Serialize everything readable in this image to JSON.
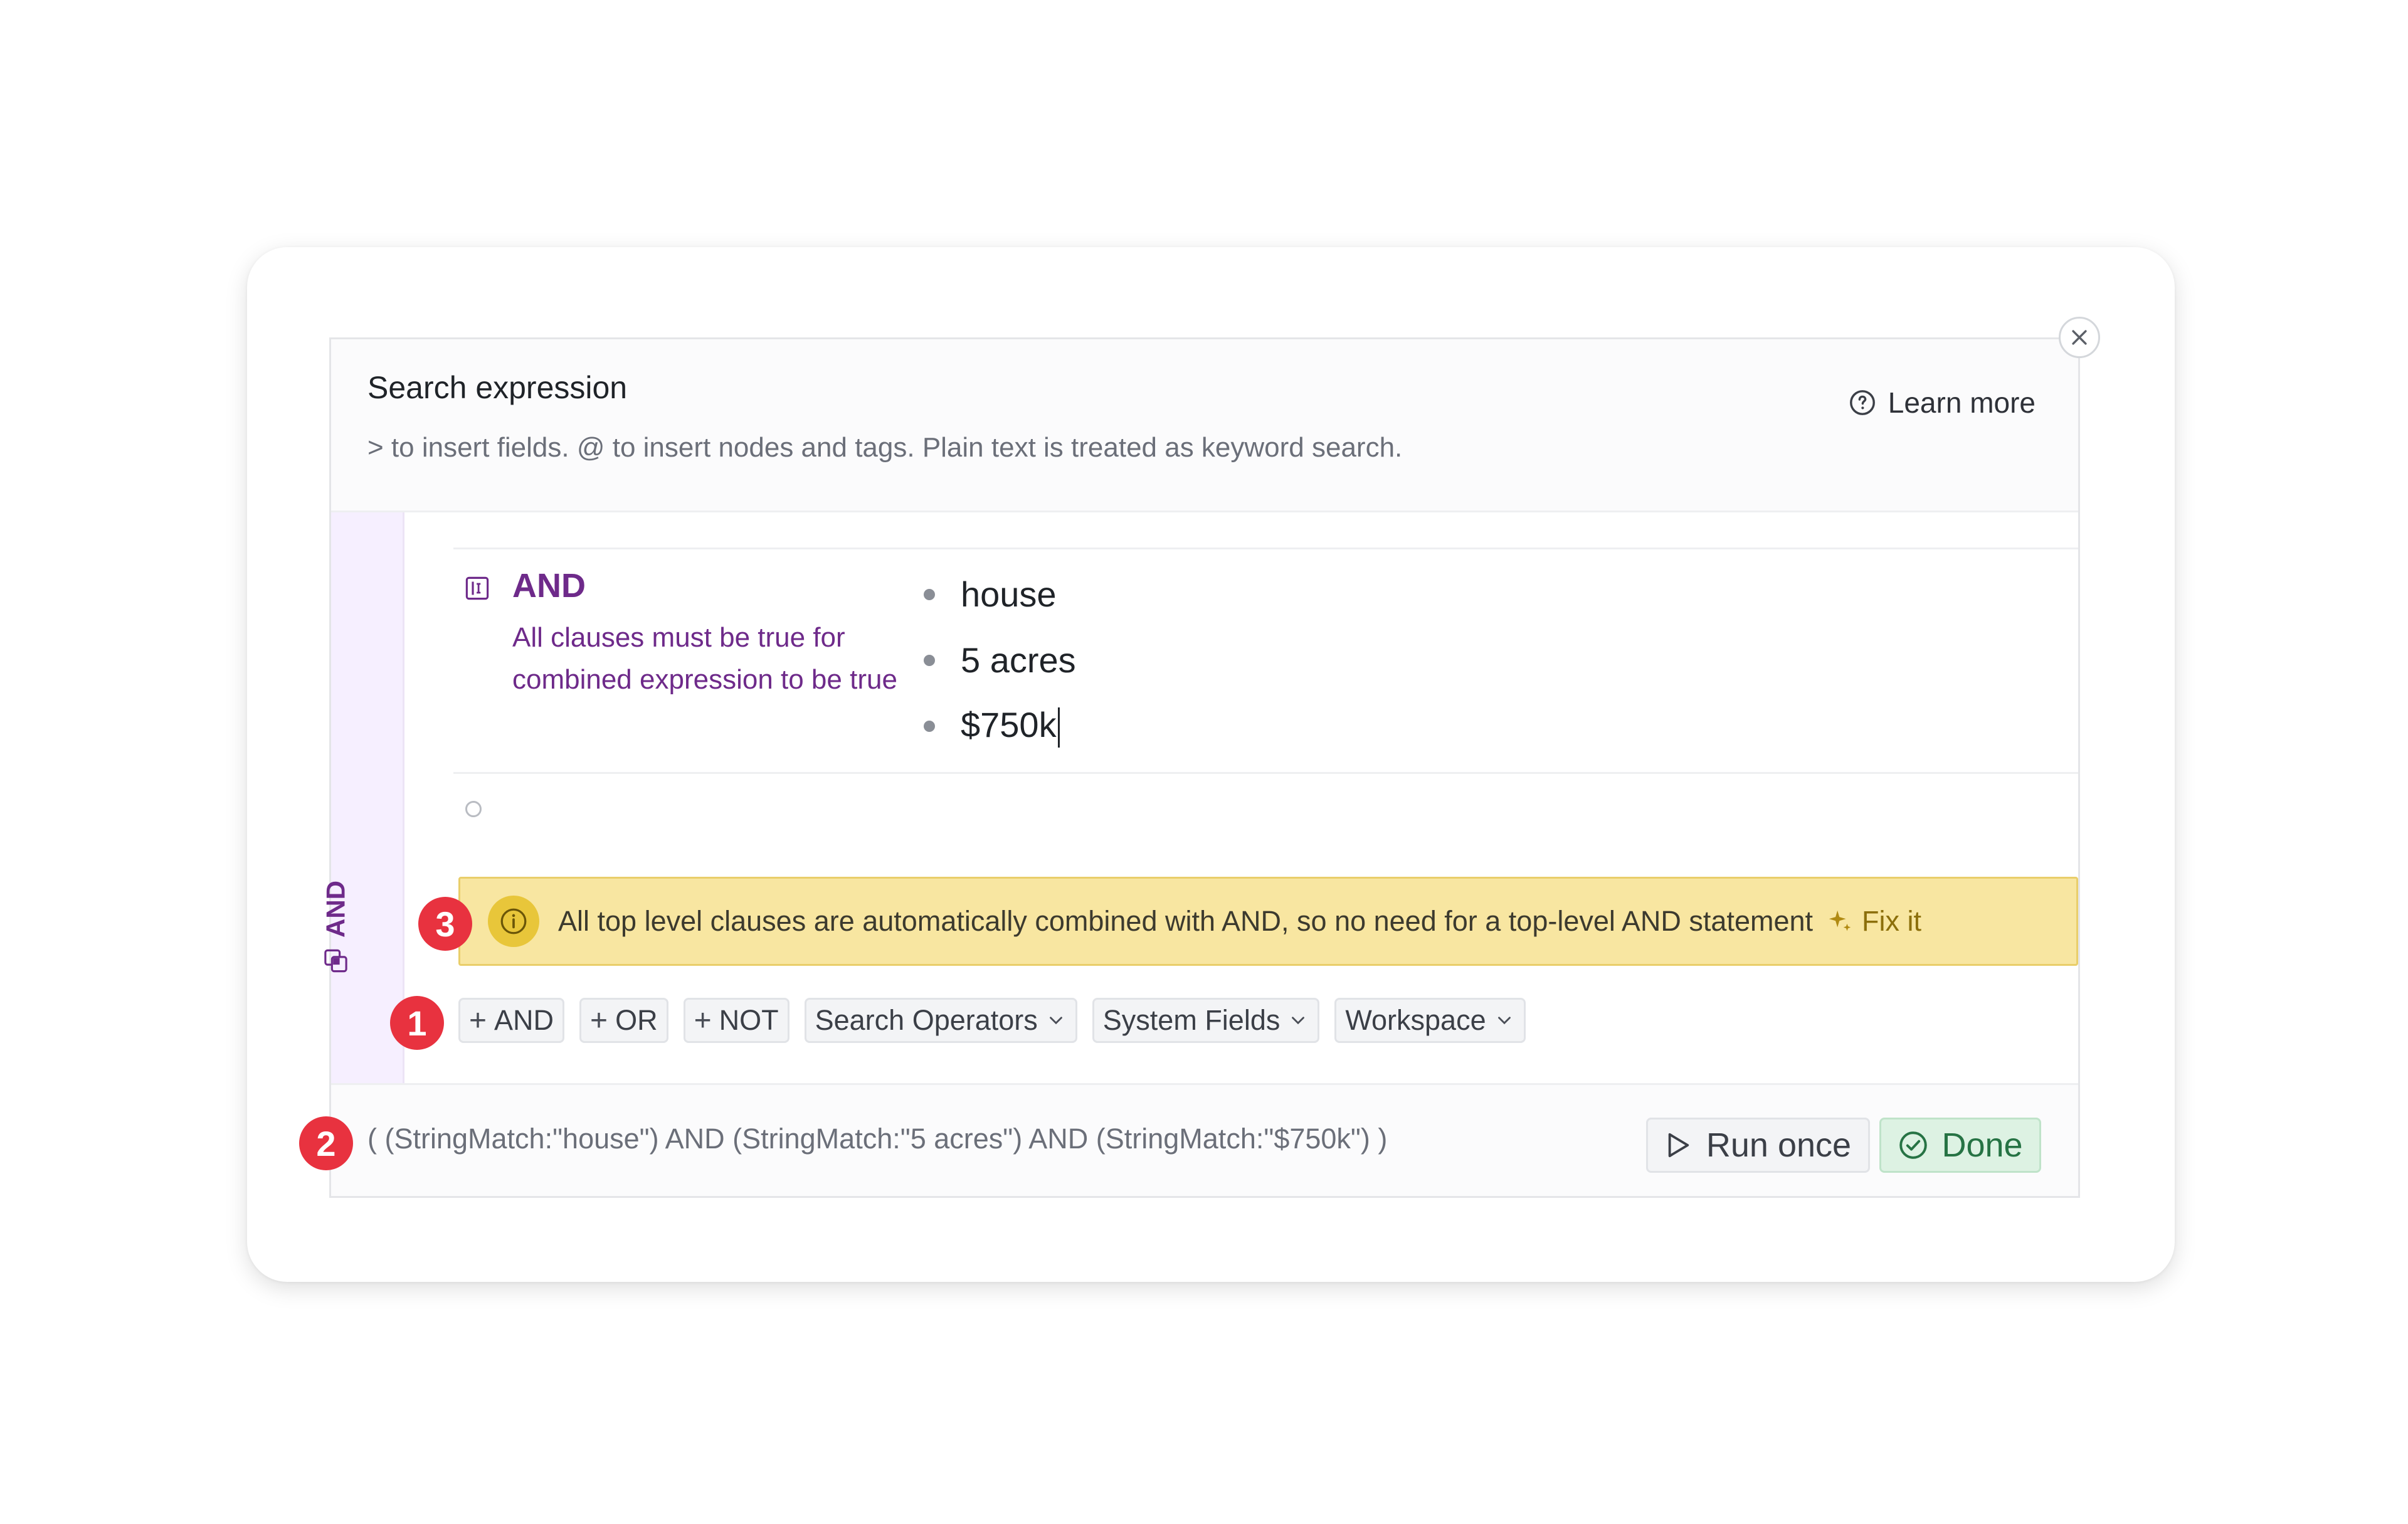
{
  "dialog": {
    "title": "Search expression",
    "hint": "> to insert fields. @ to insert nodes and tags. Plain text is treated as keyword search.",
    "learn_more": "Learn more"
  },
  "side_strip": {
    "label": "AND"
  },
  "and_block": {
    "title": "AND",
    "description": "All clauses must be true for combined expression to be true",
    "clauses": [
      "house",
      "5 acres",
      "$750k"
    ]
  },
  "warning": {
    "text": "All top level clauses are automatically combined with AND, so no need for a top-level AND statement",
    "fix_label": "Fix it"
  },
  "toolbar": {
    "plus_symbol": "+",
    "and_label": "AND",
    "or_label": "OR",
    "not_label": "NOT",
    "search_operators": "Search Operators",
    "system_fields": "System Fields",
    "workspace": "Workspace"
  },
  "footer": {
    "expression": "( (StringMatch:\"house\") AND (StringMatch:\"5 acres\") AND (StringMatch:\"$750k\") )",
    "run_once": "Run once",
    "done": "Done"
  },
  "callouts": [
    "1",
    "2",
    "3"
  ],
  "colors": {
    "accent_purple": "#6e2a8a",
    "warning_bg": "#f8e6a1",
    "done_green": "#267344",
    "callout_red": "#e8323f"
  },
  "icons": {
    "close": "close-icon",
    "help": "question-circle-icon",
    "and_block": "and-block-icon",
    "info": "info-icon",
    "sparkle": "sparkle-icon",
    "chevron": "chevron-down-icon",
    "play": "play-icon",
    "check": "check-circle-icon"
  }
}
